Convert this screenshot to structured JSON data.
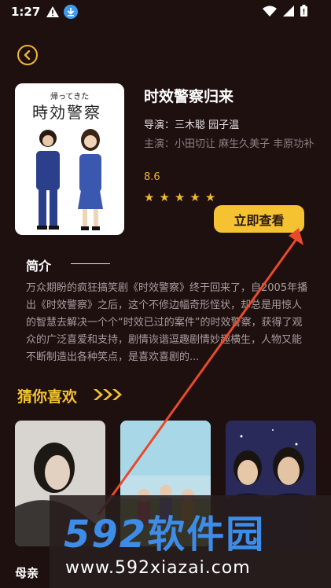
{
  "status": {
    "time": "1:27"
  },
  "movie": {
    "title": "时效警察归来",
    "director": "导演：三木聪 园子温",
    "cast": "主演：小田切让 麻生久美子 丰原功补",
    "rating": "8.6",
    "rating_stars": 5,
    "poster_caption_small": "帰ってきた",
    "poster_caption_big": "時効警察"
  },
  "actions": {
    "watch_label": "立即查看"
  },
  "intro": {
    "heading": "简介",
    "text": "万众期盼的疯狂搞笑剧《时效警察》终于回来了，自2005年播出《时效警察》之后，这个不修边幅奇形怪状，却总是用惊人的智慧去解决一个个“时效已过的案件”的时效警察，获得了观众的广泛喜爱和支持，剧情诙谐逗趣剧情妙趣横生，人物又能不断制造出各种笑点，是喜欢喜剧的..."
  },
  "recommend": {
    "heading": "猜你喜欢",
    "items": [
      {
        "label": "母亲"
      },
      {
        "label": ""
      },
      {
        "label": ""
      }
    ]
  },
  "watermark": {
    "brand_digits": "592",
    "brand_cn": "软件园",
    "url": "www.592xiazai.com"
  },
  "colors": {
    "accent": "#f5c232",
    "background": "#1f1010",
    "annotation": "#e84a2a",
    "watermark_blue": "#3d8ce8"
  }
}
